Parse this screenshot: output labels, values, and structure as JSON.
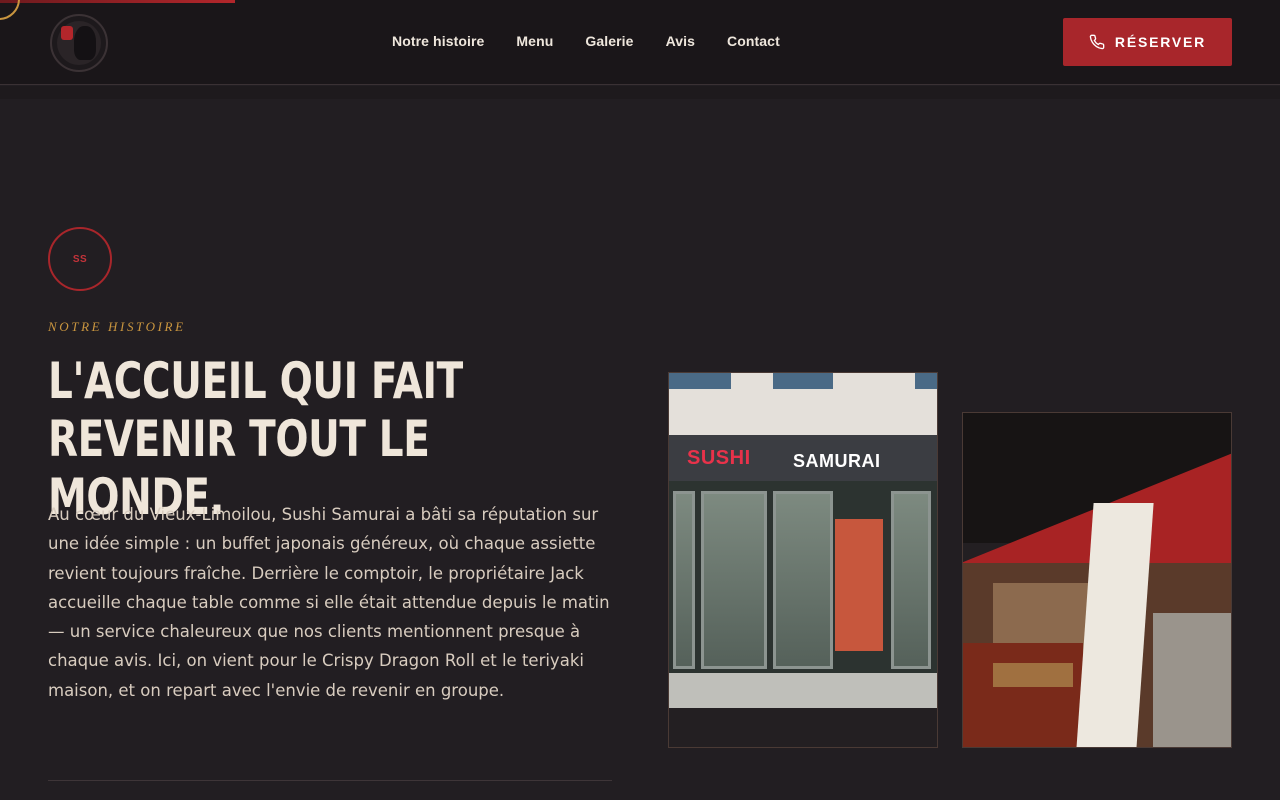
{
  "header": {
    "nav": [
      "Notre histoire",
      "Menu",
      "Galerie",
      "Avis",
      "Contact"
    ],
    "reserve_label": "RÉSERVER"
  },
  "story": {
    "badge": "SS",
    "eyebrow": "NOTRE HISTOIRE",
    "headline_line1": "L'ACCUEIL QUI FAIT",
    "headline_line2": "REVENIR TOUT LE MONDE.",
    "body": "Au cœur du Vieux-Limoilou, Sushi Samurai a bâti sa réputation sur une idée simple : un buffet japonais généreux, où chaque assiette revient toujours fraîche. Derrière le comptoir, le propriétaire Jack accueille chaque table comme si elle était attendue depuis le matin — un service chaleureux que nos clients mentionnent presque à chaque avis. Ici, on vient pour le Crispy Dragon Roll et le teriyaki maison, et on repart avec l'envie de revenir en groupe."
  },
  "photos": {
    "storefront_sign_1": "SUSHI",
    "storefront_sign_2": "SAMURAI"
  },
  "colors": {
    "accent": "#a8262b",
    "gold": "#c9953f",
    "background": "#221e22"
  }
}
